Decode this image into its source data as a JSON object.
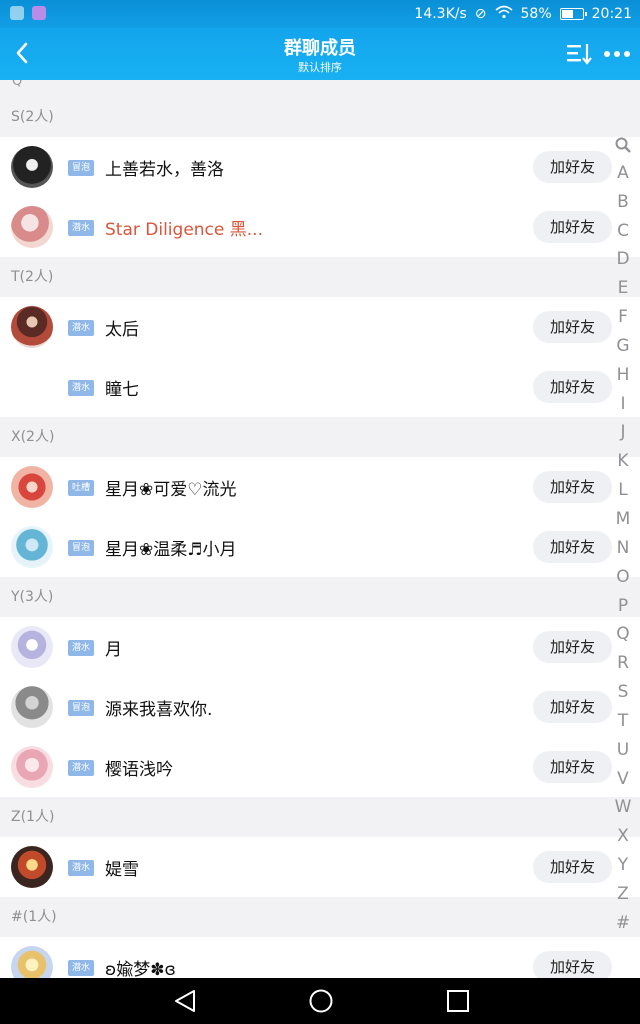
{
  "status_bar": {
    "network_speed": "14.3K/s",
    "battery_percent": "58%",
    "battery_level": 0.58,
    "time": "20:21"
  },
  "header": {
    "title": "群聊成员",
    "subtitle": "默认排序"
  },
  "list_top_cutoff": "Q",
  "sections": [
    {
      "label": "S(2人)",
      "members": [
        {
          "badge": "冒泡",
          "name": "上善若水，善洛",
          "add_label": "加好友"
        },
        {
          "badge": "潜水",
          "name": "Star Diligence 黑...",
          "add_label": "加好友",
          "highlight": true
        }
      ]
    },
    {
      "label": "T(2人)",
      "members": [
        {
          "badge": "潜水",
          "name": "太后",
          "add_label": "加好友"
        },
        {
          "badge": "潜水",
          "name": "瞳七",
          "add_label": "加好友",
          "no_avatar": true
        }
      ]
    },
    {
      "label": "X(2人)",
      "members": [
        {
          "badge": "吐槽",
          "name": "星月❀可爱♡流光",
          "add_label": "加好友"
        },
        {
          "badge": "冒泡",
          "name": "星月❀温柔♬小月",
          "add_label": "加好友"
        }
      ]
    },
    {
      "label": "Y(3人)",
      "members": [
        {
          "badge": "潜水",
          "name": "月",
          "add_label": "加好友"
        },
        {
          "badge": "冒泡",
          "name": "源来我喜欢你.",
          "add_label": "加好友"
        },
        {
          "badge": "潜水",
          "name": "樱语浅吟",
          "add_label": "加好友"
        }
      ]
    },
    {
      "label": "Z(1人)",
      "members": [
        {
          "badge": "潜水",
          "name": "媞雪",
          "add_label": "加好友"
        }
      ]
    },
    {
      "label": "#(1人)",
      "members": [
        {
          "badge": "潜水",
          "name": "ʚ婾梦✽ɞ",
          "add_label": "加好友"
        }
      ]
    }
  ],
  "index_bar": [
    "A",
    "B",
    "C",
    "D",
    "E",
    "F",
    "G",
    "H",
    "I",
    "J",
    "K",
    "L",
    "M",
    "N",
    "O",
    "P",
    "Q",
    "R",
    "S",
    "T",
    "U",
    "V",
    "W",
    "X",
    "Y",
    "Z",
    "#"
  ],
  "colors": {
    "header_blue": "#18b0f3",
    "badge_blue": "#8fb8e8",
    "highlight_name": "#d9553b",
    "section_bg": "#f2f2f5"
  },
  "icons": {
    "back": "chevron-left-icon",
    "sort": "sort-list-icon",
    "more": "more-dots-icon",
    "index_search": "search-icon"
  }
}
